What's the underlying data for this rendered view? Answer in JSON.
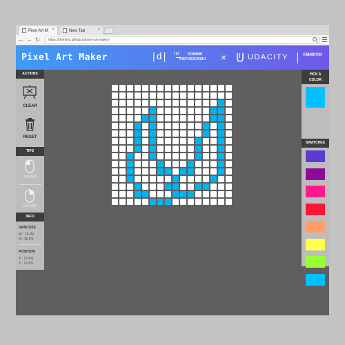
{
  "browser": {
    "tabs": [
      {
        "label": "Pixel Art M"
      },
      {
        "label": "New Tab"
      }
    ],
    "url": "https://dominic.github.io/pixel-art-maker/",
    "close_glyph": "×"
  },
  "header": {
    "app_title": "Pixel Art Maker",
    "logo_text": "|d|",
    "tm": "TM",
    "author_line1": "DOMINIK",
    "author_line2": "KIEPUSZEWSKI",
    "separator": "×",
    "partner": "UDACITY",
    "copyright": "©MMXVIII"
  },
  "left_panel": {
    "actions_heading": "ACTIONS",
    "clear_label": "CLEAR",
    "reset_label": "RESET",
    "tips_heading": "TIPS",
    "draw_label": "DRAW",
    "erase_label": "ERASE",
    "info_heading": "INFO",
    "grid_size_label": "GRID SIZE",
    "grid_w": "W : 16 PX",
    "grid_h": "H : 16 PX",
    "position_label": "POSITION",
    "pos_x": "X : 10 PX",
    "pos_y": "Y : 12 PX"
  },
  "right_panel": {
    "pick_heading_1": "PICK A",
    "pick_heading_2": "COLOR",
    "current_color": "#00c0ff",
    "swatches_heading": "SWATCHES",
    "swatches": [
      "#5c3bd1",
      "#8e0b9a",
      "#ff1a8c",
      "#ff1336",
      "#ff9e6b",
      "#ffff4d",
      "#99ff33",
      "#00c0ff"
    ]
  },
  "canvas": {
    "cols": 16,
    "rows": 16,
    "fill_color": "#00b4f0",
    "filled": [
      [
        2,
        14
      ],
      [
        3,
        5
      ],
      [
        3,
        13
      ],
      [
        3,
        14
      ],
      [
        4,
        4
      ],
      [
        4,
        5
      ],
      [
        4,
        13
      ],
      [
        4,
        14
      ],
      [
        5,
        3
      ],
      [
        5,
        5
      ],
      [
        5,
        12
      ],
      [
        5,
        14
      ],
      [
        6,
        3
      ],
      [
        6,
        5
      ],
      [
        6,
        12
      ],
      [
        6,
        14
      ],
      [
        7,
        3
      ],
      [
        7,
        5
      ],
      [
        7,
        11
      ],
      [
        7,
        14
      ],
      [
        8,
        3
      ],
      [
        8,
        5
      ],
      [
        8,
        11
      ],
      [
        8,
        14
      ],
      [
        9,
        2
      ],
      [
        9,
        5
      ],
      [
        9,
        11
      ],
      [
        9,
        14
      ],
      [
        10,
        2
      ],
      [
        10,
        6
      ],
      [
        10,
        10
      ],
      [
        10,
        14
      ],
      [
        11,
        2
      ],
      [
        11,
        6
      ],
      [
        11,
        7
      ],
      [
        11,
        9
      ],
      [
        11,
        10
      ],
      [
        11,
        14
      ],
      [
        12,
        2
      ],
      [
        12,
        8
      ],
      [
        12,
        13
      ],
      [
        13,
        3
      ],
      [
        13,
        7
      ],
      [
        13,
        8
      ],
      [
        13,
        11
      ],
      [
        13,
        12
      ],
      [
        14,
        3
      ],
      [
        14,
        4
      ],
      [
        14,
        8
      ],
      [
        14,
        9
      ],
      [
        14,
        10
      ],
      [
        15,
        5
      ],
      [
        15,
        6
      ],
      [
        15,
        7
      ]
    ]
  }
}
